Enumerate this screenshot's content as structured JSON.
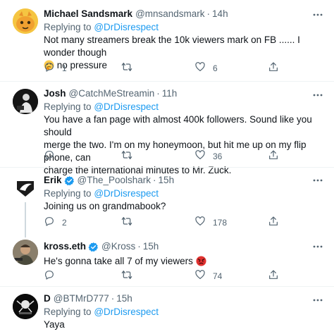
{
  "tweets": [
    {
      "name": "Michael Sandsmark",
      "handle": "@mnsandsmark",
      "dot": "·",
      "time": "14h",
      "replying_prefix": "Replying to",
      "replying_to": "@DrDisrespect",
      "text_line1": "Not many streamers break the 10k viewers mark on FB ...... I wonder though",
      "text_line2_after_emoji": " no pressure",
      "emoji": "thinking-face",
      "replies": "1",
      "retweets": "",
      "likes": "6"
    },
    {
      "name": "Josh",
      "handle": "@CatchMeStreamin",
      "dot": "·",
      "time": "11h",
      "replying_prefix": "Replying to",
      "replying_to": "@DrDisrespect",
      "text_lines": [
        "You have a fan page with almost 400k followers. Sound like you should",
        "merge the two. I'm on my honeymoon, but hit me up on my flip phone, can",
        "charge the international minutes to Mr. Zuck."
      ],
      "replies": "",
      "retweets": "",
      "likes": "36"
    },
    {
      "name": "Erik",
      "handle": "@The_Poolshark",
      "dot": "·",
      "time": "15h",
      "replying_prefix": "Replying to",
      "replying_to": "@DrDisrespect",
      "text": "Joining us on grandmabook?",
      "replies": "2",
      "retweets": "",
      "likes": "178"
    },
    {
      "name": "kross.eth",
      "handle": "@Kross",
      "dot": "·",
      "time": "15h",
      "text": "He's gonna take all 7 of my viewers",
      "emoji": "angry-face",
      "replies": "",
      "retweets": "",
      "likes": "74"
    },
    {
      "name": "D",
      "handle": "@BTMrD777",
      "dot": "·",
      "time": "15h",
      "replying_prefix": "Replying to",
      "replying_to": "@DrDisrespect",
      "text": "Yaya"
    }
  ],
  "colors": {
    "text": "#0f1419",
    "secondary": "#536471",
    "accent": "#1d9bf0",
    "divider": "#eff3f4"
  }
}
